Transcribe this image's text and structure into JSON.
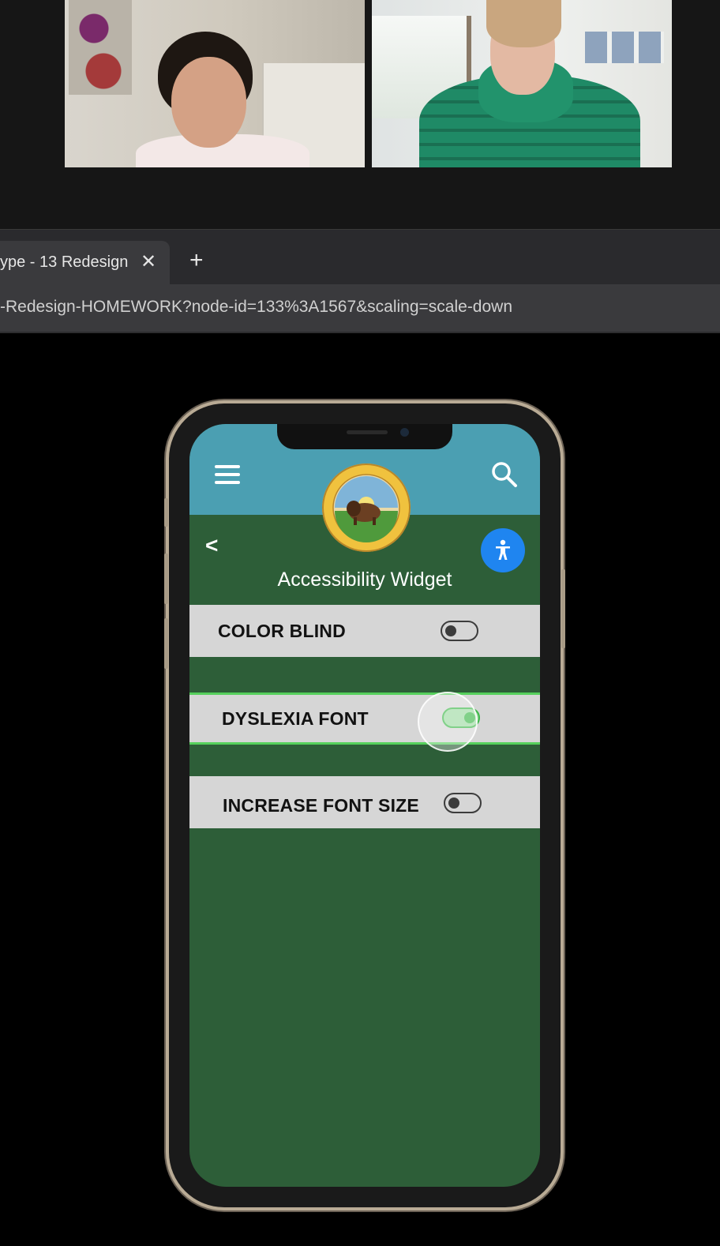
{
  "browser": {
    "tab_title": "ype - 13 Redesign",
    "tab_close": "✕",
    "new_tab": "+",
    "url": "-Redesign-HOMEWORK?node-id=133%3A1567&scaling=scale-down"
  },
  "app": {
    "back_label": "<",
    "title": "Accessibility Widget",
    "options": [
      {
        "label": "COLOR BLIND",
        "enabled": false
      },
      {
        "label": "DYSLEXIA FONT",
        "enabled": true
      },
      {
        "label": "INCREASE FONT SIZE",
        "enabled": false
      }
    ]
  },
  "colors": {
    "header_blue": "#4b9fb2",
    "app_green": "#2d5e38",
    "accessibility_button_blue": "#1f85f0",
    "toggle_on_green": "#3eb84a"
  },
  "icons": [
    "menu-icon",
    "search-icon",
    "department-seal-logo",
    "accessibility-person-icon",
    "close-icon",
    "plus-icon"
  ]
}
